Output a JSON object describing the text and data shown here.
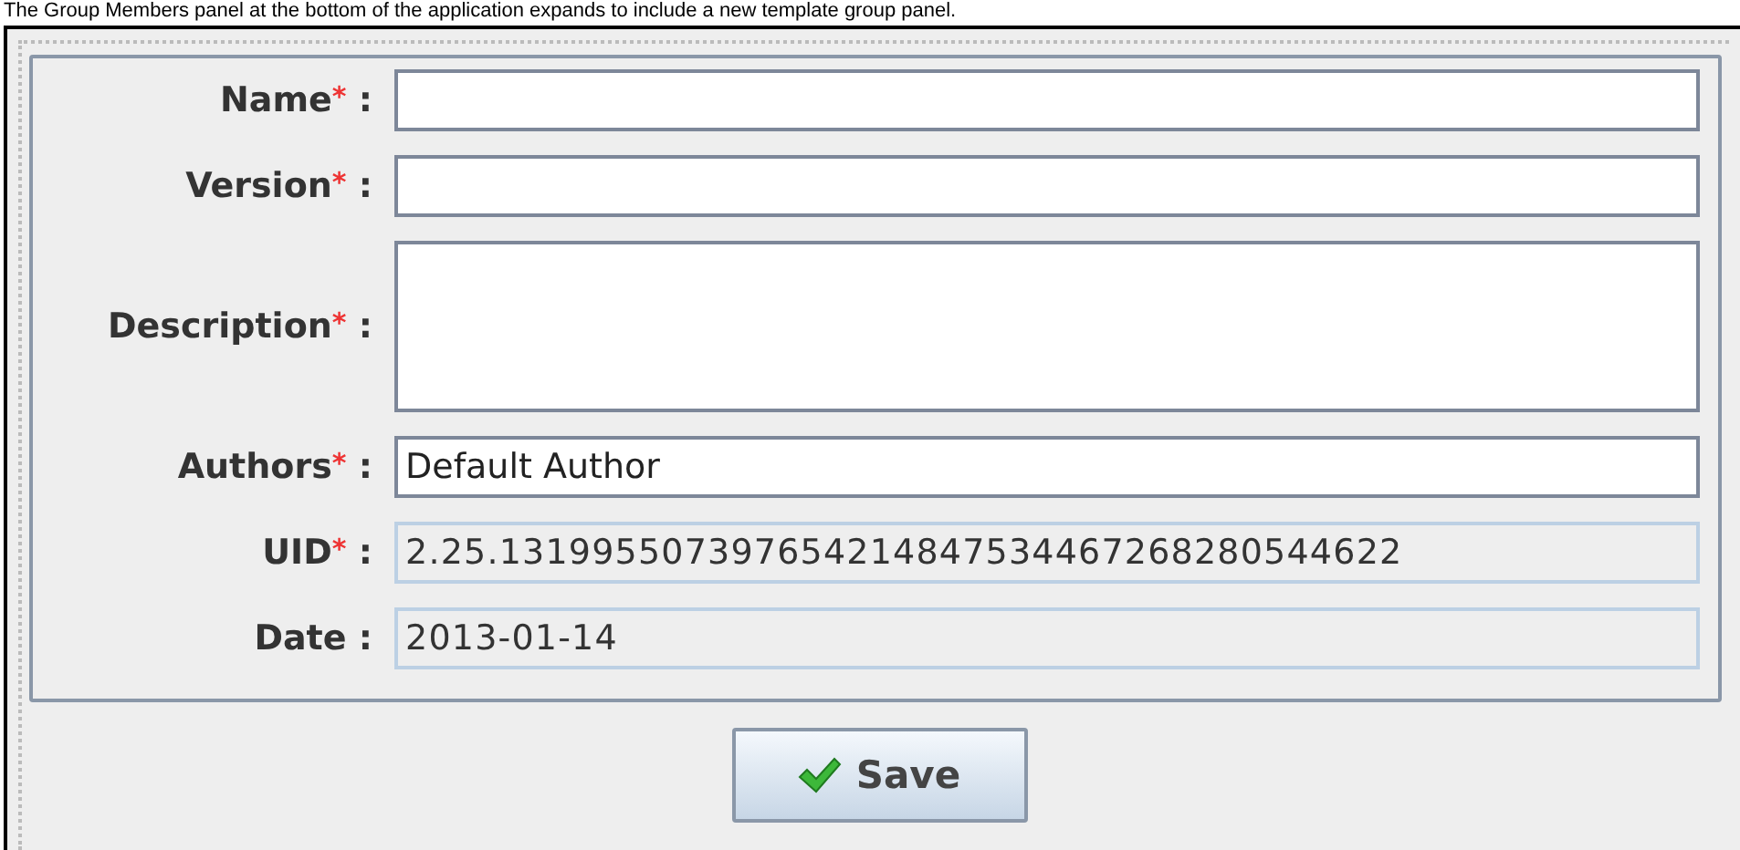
{
  "caption": "The Group Members panel at the bottom of the application expands to include a new template group panel.",
  "fields": [
    {
      "label": "Name",
      "required_mark": "*",
      "colon": ":",
      "kind": "text",
      "readonly": false
    },
    {
      "label": "Version",
      "required_mark": "*",
      "colon": ":",
      "kind": "text",
      "readonly": false
    },
    {
      "label": "Description",
      "required_mark": "*",
      "colon": ":",
      "kind": "textarea",
      "readonly": false
    },
    {
      "label": "Authors",
      "required_mark": "*",
      "colon": ":",
      "kind": "text",
      "value": "Default Author",
      "readonly": false
    },
    {
      "label": "UID",
      "required_mark": "*",
      "colon": ":",
      "kind": "text",
      "value": "2.25.131995507397654214847534467268280544622",
      "readonly": true
    },
    {
      "label": "Date",
      "colon": ":",
      "kind": "text",
      "value": "2013-01-14",
      "readonly": true
    }
  ],
  "save_button": {
    "label": "Save"
  }
}
